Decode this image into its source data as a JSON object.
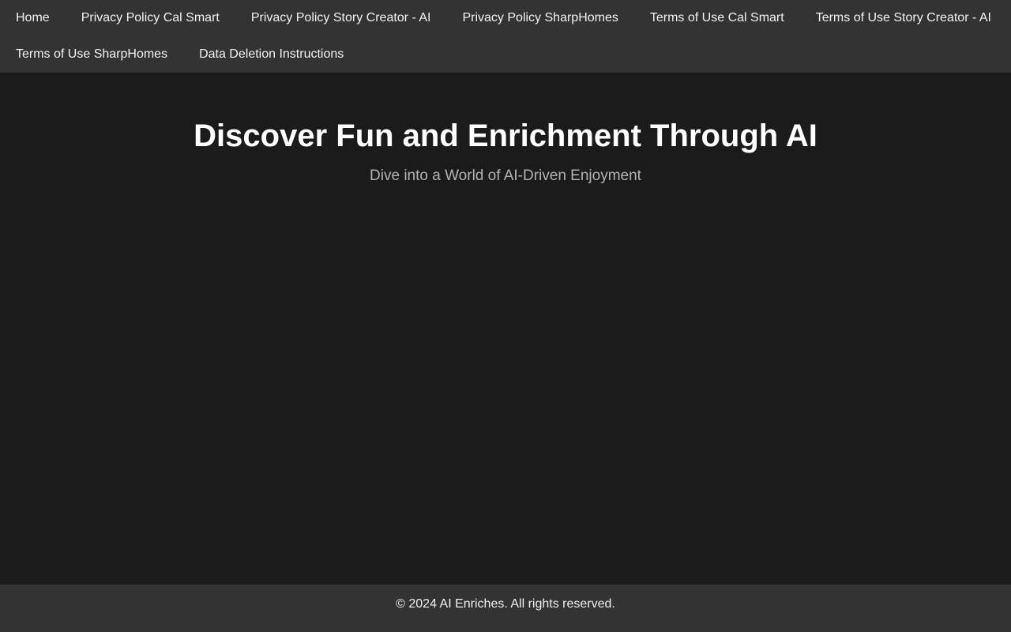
{
  "nav": {
    "items": [
      {
        "label": "Home"
      },
      {
        "label": "Privacy Policy Cal Smart"
      },
      {
        "label": "Privacy Policy Story Creator - AI"
      },
      {
        "label": "Privacy Policy SharpHomes"
      },
      {
        "label": "Terms of Use Cal Smart"
      },
      {
        "label": "Terms of Use Story Creator - AI"
      },
      {
        "label": "Terms of Use SharpHomes"
      },
      {
        "label": "Data Deletion Instructions"
      }
    ]
  },
  "hero": {
    "title": "Discover Fun and Enrichment Through AI",
    "subtitle": "Dive into a World of AI-Driven Enjoyment"
  },
  "footer": {
    "text": "© 2024 AI Enriches. All rights reserved."
  },
  "colors": {
    "background": "#1b1b1b",
    "nav_background": "#333333",
    "footer_background": "#333333",
    "text": "#f2f2f2",
    "subtitle": "#b3b3b3"
  }
}
